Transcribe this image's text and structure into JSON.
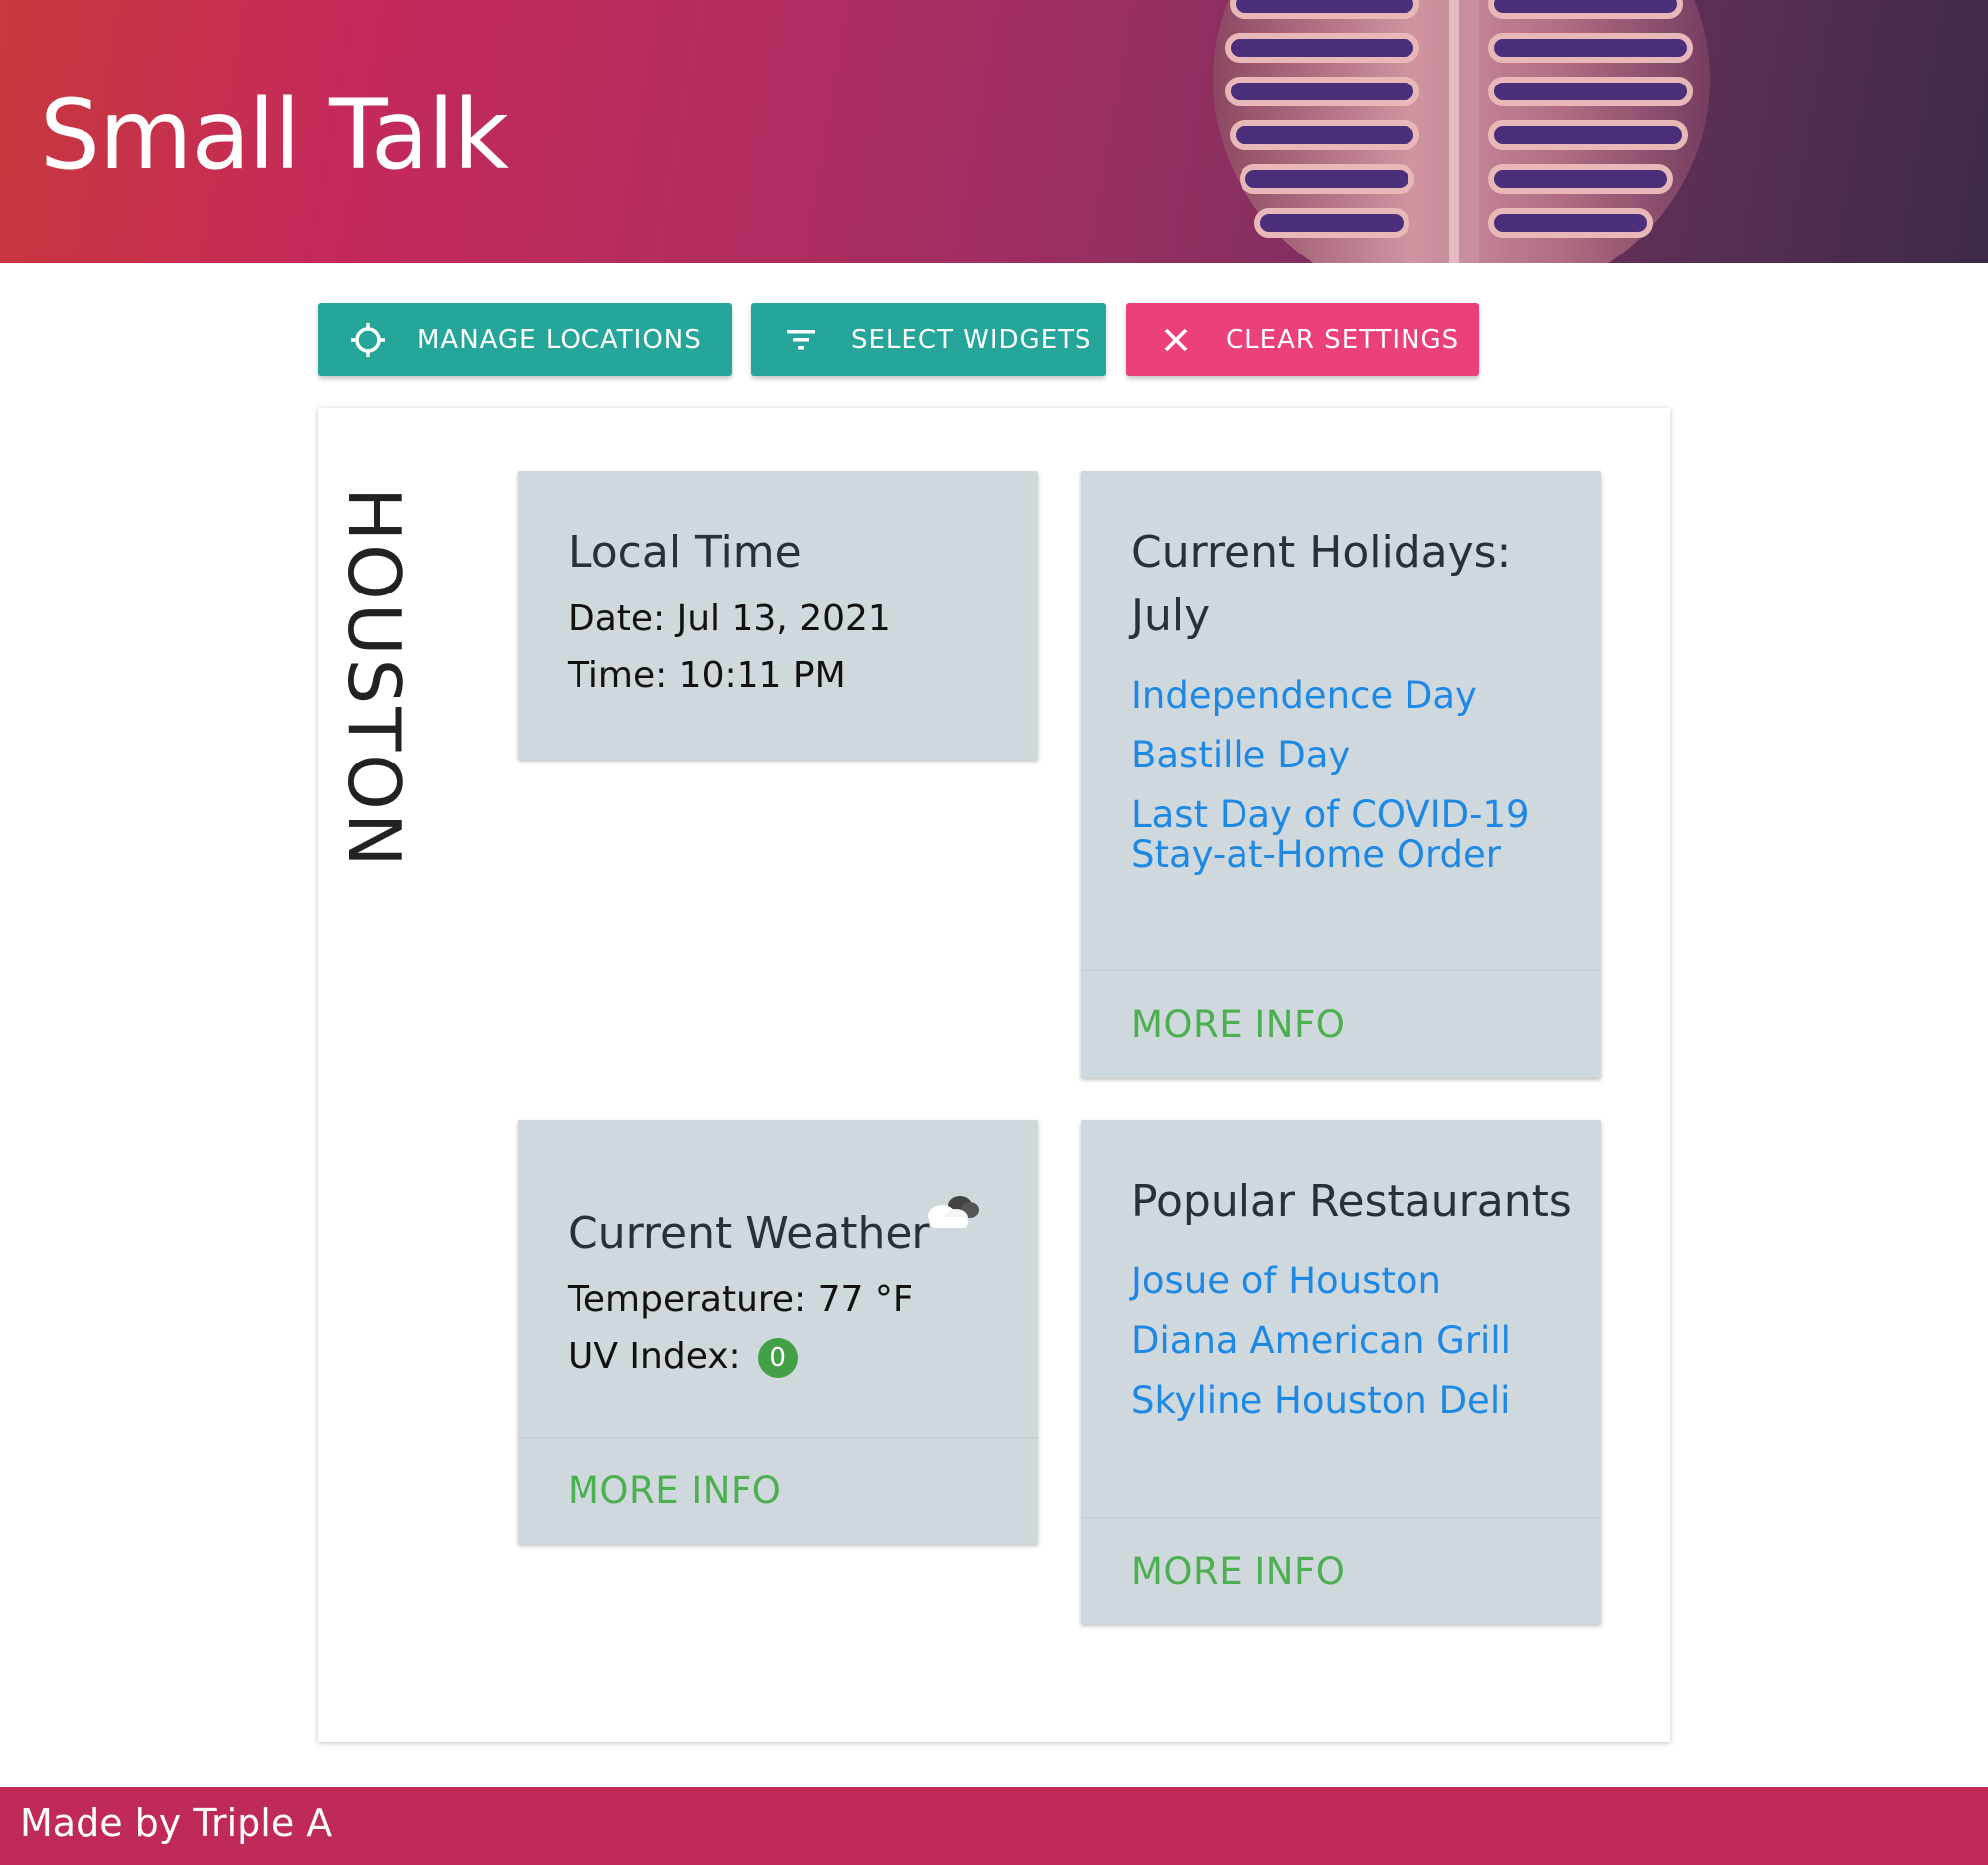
{
  "header": {
    "title": "Small Talk",
    "banner_image": "microphone-image"
  },
  "toolbar": {
    "manage_locations": {
      "label": "MANAGE LOCATIONS",
      "icon": "crosshair-icon"
    },
    "select_widgets": {
      "label": "SELECT WIDGETS",
      "icon": "filter-icon"
    },
    "clear_settings": {
      "label": "CLEAR SETTINGS",
      "icon": "close-icon"
    }
  },
  "location": {
    "city": "HOUSTON"
  },
  "widgets": {
    "local_time": {
      "title": "Local Time",
      "date": "Date: Jul 13, 2021",
      "time": "Time: 10:11 PM"
    },
    "holidays": {
      "title_line1": "Current Holidays:",
      "title_line2": "July",
      "items": [
        "Independence Day",
        "Bastille Day",
        "Last Day of COVID-19 Stay-at-Home Order"
      ],
      "more_info": "MORE INFO"
    },
    "weather": {
      "title": "Current Weather",
      "icon": "cloud-icon",
      "temperature": "Temperature: 77 °F",
      "uv_label": "UV Index:",
      "uv_value": "0",
      "more_info": "MORE INFO"
    },
    "restaurants": {
      "title": "Popular Restaurants",
      "items": [
        "Josue of Houston",
        "Diana American Grill",
        "Skyline Houston Deli"
      ],
      "more_info": "MORE INFO"
    }
  },
  "footer": {
    "text": "Made by Triple A"
  },
  "colors": {
    "teal": "#26a69a",
    "pink": "#ec407a",
    "card_bg": "#cfd8dc",
    "link": "#1e88e5",
    "more_info": "#4caf50",
    "footer": "#c02a57"
  }
}
